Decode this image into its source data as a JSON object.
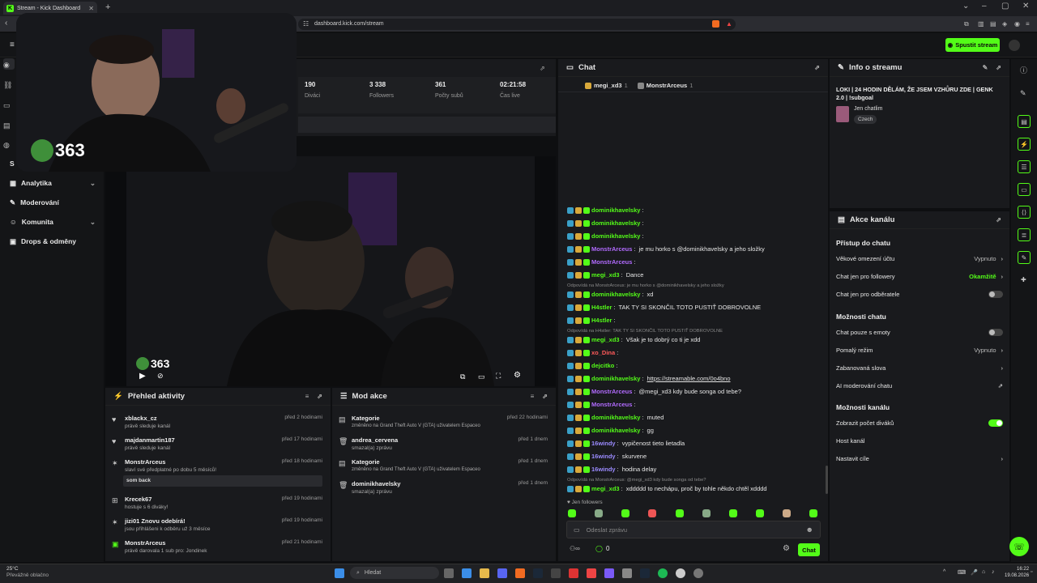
{
  "browser": {
    "tab_title": "Stream - Kick Dashboard",
    "url": "dashboard.kick.com/stream"
  },
  "header": {
    "start_stream_label": "Spustit stream"
  },
  "sidebar": {
    "items": [
      {
        "label": "S",
        "icon": "stream-icon"
      },
      {
        "label": "Analytika",
        "icon": "chart-icon",
        "chevron": true
      },
      {
        "label": "Moderování",
        "icon": "wrench-icon"
      },
      {
        "label": "Komunita",
        "icon": "users-icon",
        "chevron": true
      },
      {
        "label": "Drops & odměny",
        "icon": "gift-icon"
      }
    ]
  },
  "webcam": {
    "overlay_number": "363"
  },
  "player": {
    "overlay_number": "363"
  },
  "stats": [
    {
      "value": "190",
      "label": "Diváci"
    },
    {
      "value": "3 338",
      "label": "Followers"
    },
    {
      "value": "361",
      "label": "Počty subů"
    },
    {
      "value": "02:21:58",
      "label": "Čas live"
    }
  ],
  "activity": {
    "title": "Přehled aktivity",
    "items": [
      {
        "user": "xblackx_cz",
        "desc": "právě sleduje kanál",
        "time": "před 2 hodinami",
        "icon": "heart-icon"
      },
      {
        "user": "majdanmartin187",
        "desc": "právě sleduje kanál",
        "time": "před 17 hodinami",
        "icon": "heart-icon"
      },
      {
        "user": "MonstrArceus",
        "desc": "slaví své předplatné po dobu 5 měsíců!",
        "time": "před 18 hodinami",
        "icon": "star-icon",
        "message": "som back"
      },
      {
        "user": "Krecek67",
        "desc": "hostuje s 6 diváky!",
        "time": "před 19 hodinami",
        "icon": "host-icon"
      },
      {
        "user": "jizi01 Znovu odebírá!",
        "desc": "jsou přihlášeni k odběru už 3 měsíce",
        "time": "před 19 hodinami",
        "icon": "star-icon"
      },
      {
        "user": "MonstrArceus",
        "desc": "právě darovala 1 sub pro: Jondinek",
        "time": "před 21 hodinami",
        "icon": "gift-icon"
      }
    ]
  },
  "mod": {
    "title": "Mod akce",
    "items": [
      {
        "title": "Kategorie",
        "desc": "změněno na Grand Theft Auto V (GTA) uživatelem Espaceo",
        "time": "před 22 hodinami"
      },
      {
        "title": "andrea_cervena",
        "desc": "smazal(a) zprávu",
        "time": "před 1 dnem"
      },
      {
        "title": "Kategorie",
        "desc": "změněno na Grand Theft Auto V (GTA) uživatelem Espaceo",
        "time": "před 1 dnem"
      },
      {
        "title": "dominikhavelsky",
        "desc": "smazal(a) zprávu",
        "time": "před 1 dnem"
      }
    ]
  },
  "chat": {
    "title": "Chat",
    "top_users": [
      {
        "name": "megi_xd3",
        "count": "1"
      },
      {
        "name": "MonstrArceus",
        "count": "1"
      }
    ],
    "messages": [
      {
        "user": "dominikhavelsky",
        "text": "",
        "color": "#53fc18"
      },
      {
        "user": "dominikhavelsky",
        "text": "",
        "color": "#53fc18"
      },
      {
        "user": "dominikhavelsky",
        "text": "",
        "color": "#53fc18"
      },
      {
        "user": "MonstrArceus",
        "text": "je mu horko s @dominikhavelsky a jeho složky",
        "color": "#b26bff"
      },
      {
        "user": "MonstrArceus",
        "text": "",
        "color": "#b26bff"
      },
      {
        "user": "megi_xd3",
        "text": "Dance",
        "color": "#53fc18"
      },
      {
        "reply": "Odpovídá na MonstrArceus: je mu horko s @dominikhavelsky a jeho složky"
      },
      {
        "user": "dominikhavelsky",
        "text": "xd",
        "color": "#53fc18"
      },
      {
        "user": "H4stler",
        "text": "TAK TY SI SKONČIL TOTO PUSTIŤ DOBROVOLNE",
        "color": "#53fc18"
      },
      {
        "user": "H4stler",
        "text": "",
        "color": "#53fc18"
      },
      {
        "reply": "Odpovídá na H4stler: TAK TY SI SKONČIL TOTO PUSTIŤ DOBROVOLNE"
      },
      {
        "user": "megi_xd3",
        "text": "Však je to dobrý co ti je xdd",
        "color": "#53fc18"
      },
      {
        "user": "xo_Dina",
        "text": "",
        "color": "#ff5a5a"
      },
      {
        "user": "dejcitko",
        "text": "",
        "color": "#53fc18"
      },
      {
        "user": "dominikhavelsky",
        "text": "https://streamable.com/0o4bno",
        "color": "#53fc18"
      },
      {
        "user": "MonstrArceus",
        "text": "@megi_xd3 kdy bude songa od tebe?",
        "color": "#b26bff"
      },
      {
        "user": "MonstrArceus",
        "text": "",
        "color": "#b26bff"
      },
      {
        "user": "dominikhavelsky",
        "text": "muted",
        "color": "#53fc18"
      },
      {
        "user": "dominikhavelsky",
        "text": "gg",
        "color": "#53fc18"
      },
      {
        "user": "16windy",
        "text": "vypičenost tieto lietadla",
        "color": "#9b8bff"
      },
      {
        "user": "16windy",
        "text": "skurvene",
        "color": "#9b8bff"
      },
      {
        "user": "16windy",
        "text": "hodina delay",
        "color": "#9b8bff"
      },
      {
        "reply": "Odpovídá na MonstrArceus: @megi_xd3 kdy bude songa od tebe?"
      },
      {
        "user": "megi_xd3",
        "text": "xddddd to nechápu, proč by tohle někdo chtěl xdddd",
        "color": "#53fc18"
      }
    ],
    "followers_only": "Jen followers",
    "input_placeholder": "Odeslat zprávu",
    "counter": "0",
    "send_label": "Chat"
  },
  "stream_info": {
    "title": "Info o streamu",
    "stream_title": "LOKI | 24 HODIN DĚLÁM, ŽE JSEM VZHŮRU ZDE | GENK 2.0 | !subgoal",
    "category": "Jen chatlim",
    "language": "Czech"
  },
  "channel_actions": {
    "title": "Akce kanálu",
    "sections": [
      {
        "heading": "Přístup do chatu",
        "rows": [
          {
            "label": "Věkové omezení účtu",
            "value": "Vypnuto",
            "type": "chevron"
          },
          {
            "label": "Chat jen pro followery",
            "value": "Okamžitě",
            "type": "chevron"
          },
          {
            "label": "Chat jen pro odběratele",
            "value": "",
            "type": "toggle-off"
          }
        ]
      },
      {
        "heading": "Možnosti chatu",
        "rows": [
          {
            "label": "Chat pouze s emoty",
            "value": "",
            "type": "toggle-off"
          },
          {
            "label": "Pomalý režim",
            "value": "Vypnuto",
            "type": "chevron"
          },
          {
            "label": "Zabanovaná slova",
            "value": "",
            "type": "chevron"
          },
          {
            "label": "AI moderování chatu",
            "value": "",
            "type": "external"
          }
        ]
      },
      {
        "heading": "Možnosti kanálu",
        "rows": [
          {
            "label": "Zobrazit počet diváků",
            "value": "",
            "type": "toggle-on"
          },
          {
            "label": "Host kanál",
            "value": "",
            "type": "none"
          },
          {
            "label": "Nastavit cíle",
            "value": "",
            "type": "chevron"
          }
        ]
      }
    ]
  },
  "taskbar": {
    "weather_temp": "25°C",
    "weather_desc": "Převážně oblačno",
    "search_placeholder": "Hledat",
    "time": "16:22",
    "date": "19.08.2026"
  },
  "colors": {
    "accent": "#53fc18",
    "panel": "#191a1d",
    "bg": "#0e0f11"
  }
}
